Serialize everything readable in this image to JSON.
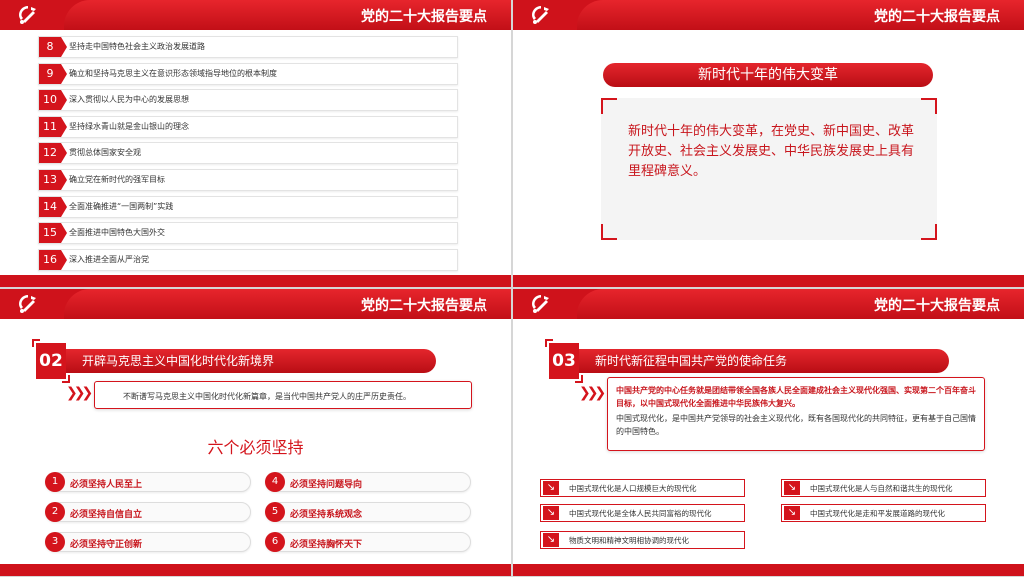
{
  "header_title": "党的二十大报告要点",
  "slide1": {
    "items": [
      {
        "num": "8",
        "text": "坚持走中国特色社会主义政治发展道路"
      },
      {
        "num": "9",
        "text": "确立和坚持马克思主义在意识形态领域指导地位的根本制度"
      },
      {
        "num": "10",
        "text": "深入贯彻以人民为中心的发展思想"
      },
      {
        "num": "11",
        "text": "坚持绿水青山就是金山银山的理念"
      },
      {
        "num": "12",
        "text": "贯彻总体国家安全观"
      },
      {
        "num": "13",
        "text": "确立党在新时代的强军目标"
      },
      {
        "num": "14",
        "text": "全面准确推进“一国两制”实践"
      },
      {
        "num": "15",
        "text": "全面推进中国特色大国外交"
      },
      {
        "num": "16",
        "text": "深入推进全面从严治党"
      }
    ]
  },
  "slide2": {
    "pill": "新时代十年的伟大变革",
    "quote": "新时代十年的伟大变革，在党史、新中国史、改革开放史、社会主义发展史、中华民族发展史上具有里程碑意义。"
  },
  "slide3": {
    "num": "02",
    "section": "开辟马克思主义中国化时代化新境界",
    "callout": "不断谱写马克思主义中国化时代化新篇章，是当代中国共产党人的庄严历史责任。",
    "heading": "六个必须坚持",
    "musts": [
      {
        "num": "1",
        "label": "必须坚持人民至上"
      },
      {
        "num": "2",
        "label": "必须坚持自信自立"
      },
      {
        "num": "3",
        "label": "必须坚持守正创新"
      },
      {
        "num": "4",
        "label": "必须坚持问题导向"
      },
      {
        "num": "5",
        "label": "必须坚持系统观念"
      },
      {
        "num": "6",
        "label": "必须坚持胸怀天下"
      }
    ]
  },
  "slide4": {
    "num": "03",
    "section": "新时代新征程中国共产党的使命任务",
    "callout_bold": "中国共产党的中心任务就是团结带领全国各族人民全面建成社会主义现代化强国、实现第二个百年奋斗目标，以中国式现代化全面推进中华民族伟大复兴。",
    "callout_body": "中国式现代化，是中国共产党领导的社会主义现代化，既有各国现代化的共同特征，更有基于自己国情的中国特色。",
    "features": [
      "中国式现代化是人口规模巨大的现代化",
      "中国式现代化是人与自然和谐共生的现代化",
      "中国式现代化是全体人民共同富裕的现代化",
      "中国式现代化是走和平发展道路的现代化",
      "物质文明和精神文明相协调的现代化"
    ]
  }
}
